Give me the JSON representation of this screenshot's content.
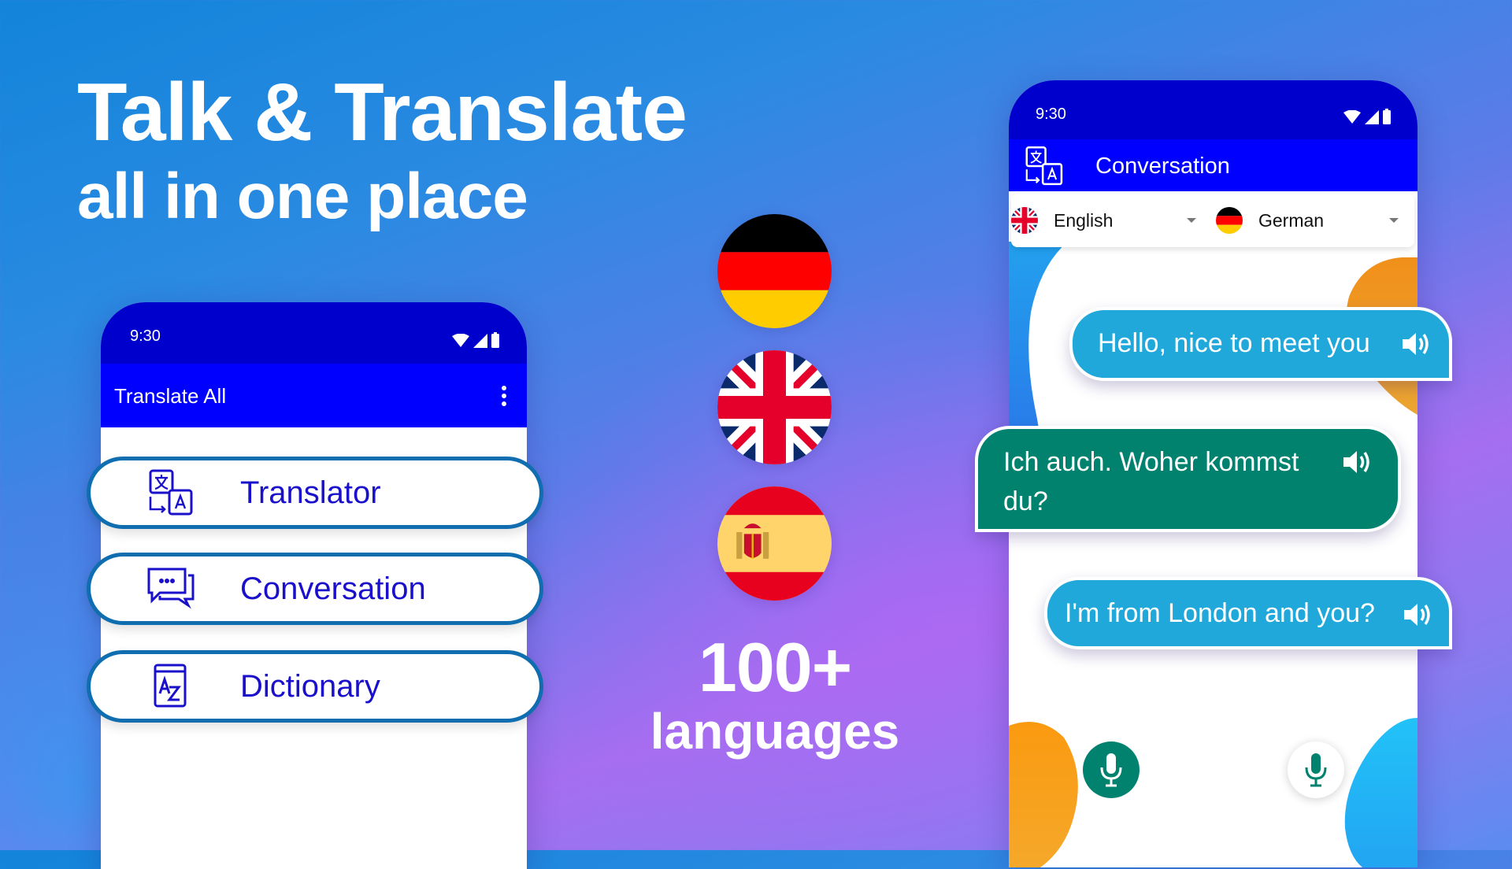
{
  "headline": {
    "line1": "Talk & Translate",
    "line2": "all in one place"
  },
  "colors": {
    "status_bar": "#0000CC",
    "app_bar": "#0000FF",
    "pill_border": "#106EB0",
    "pill_text": "#1A10CC",
    "bubble_blue": "#1FA8D9",
    "bubble_green": "#00826F",
    "accent_orange": "#F39A1A"
  },
  "left_phone": {
    "status_time": "9:30",
    "status_icons": [
      "wifi-icon",
      "signal-icon",
      "battery-icon"
    ],
    "app_title": "Translate All",
    "menu_icon": "more-vert-icon",
    "menu_items": [
      {
        "label": "Translator",
        "icon": "translate-icon"
      },
      {
        "label": "Conversation",
        "icon": "chat-bubbles-icon"
      },
      {
        "label": "Dictionary",
        "icon": "dictionary-az-icon"
      }
    ]
  },
  "center": {
    "flags": [
      "Germany",
      "United Kingdom",
      "Spain"
    ],
    "count": "100+",
    "count_label": "languages"
  },
  "right_phone": {
    "status_time": "9:30",
    "status_icons": [
      "wifi-icon",
      "signal-icon",
      "battery-icon"
    ],
    "app_title": "Conversation",
    "app_icon": "translate-icon",
    "source_language": "English",
    "target_language": "German",
    "messages": [
      {
        "text": "Hello, nice to meet you",
        "side": "right",
        "color": "blue"
      },
      {
        "text": "Ich auch. Woher kommst du?",
        "side": "left",
        "color": "green"
      },
      {
        "text": "I'm from London and you?",
        "side": "right",
        "color": "blue"
      }
    ],
    "mic_buttons": [
      "mic-source",
      "mic-target"
    ]
  }
}
